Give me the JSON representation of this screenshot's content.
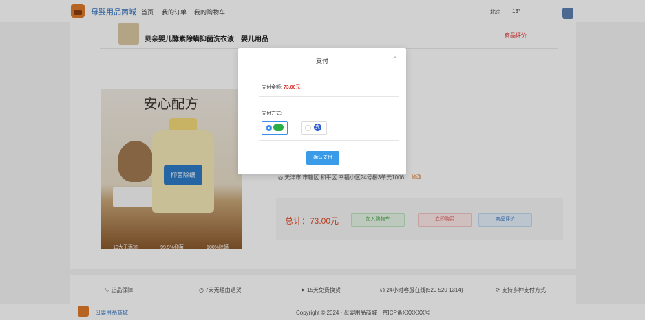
{
  "header": {
    "site_name": "母婴用品商城",
    "nav": [
      "首页",
      "我的订单",
      "我的购物车"
    ],
    "city": "北京",
    "temperature": "13°"
  },
  "product": {
    "title": "贝亲婴儿酵素除螨抑菌洗衣液　婴儿用品",
    "review_link": "商品评价",
    "image_heading": "安心配方",
    "bottle_label": "抑菌除螨",
    "features": [
      "10大无添加",
      "99.9%抑菌",
      "100%除螨"
    ],
    "address": "天津市 市辖区 和平区 幸福小区24号楼3单元1006",
    "address_edit": "修改",
    "total": "总计：73.00元",
    "buttons": {
      "add_cart": "加入购物车",
      "buy_now": "立即购买",
      "reviews": "商品评价"
    }
  },
  "services": [
    "正品保障",
    "7天无理由退货",
    "15天免费换货",
    "24小时客服在线(520 520 1314)",
    "支持多种支付方式"
  ],
  "footer": {
    "site_name": "母婴用品商城",
    "copyright": "Copyright © 2024 · 母婴用品商城　京ICP备XXXXXX号"
  },
  "modal": {
    "title": "支付",
    "close": "×",
    "amount_label": "支付金额:",
    "amount_value": "73.00元",
    "method_label": "支付方式:",
    "methods": [
      {
        "name": "wechat",
        "selected": true
      },
      {
        "name": "alipay",
        "selected": false
      }
    ],
    "confirm": "确认支付"
  },
  "colors": {
    "accent": "#3a9be8",
    "price": "#e0302a",
    "brand": "#e07a2a"
  }
}
